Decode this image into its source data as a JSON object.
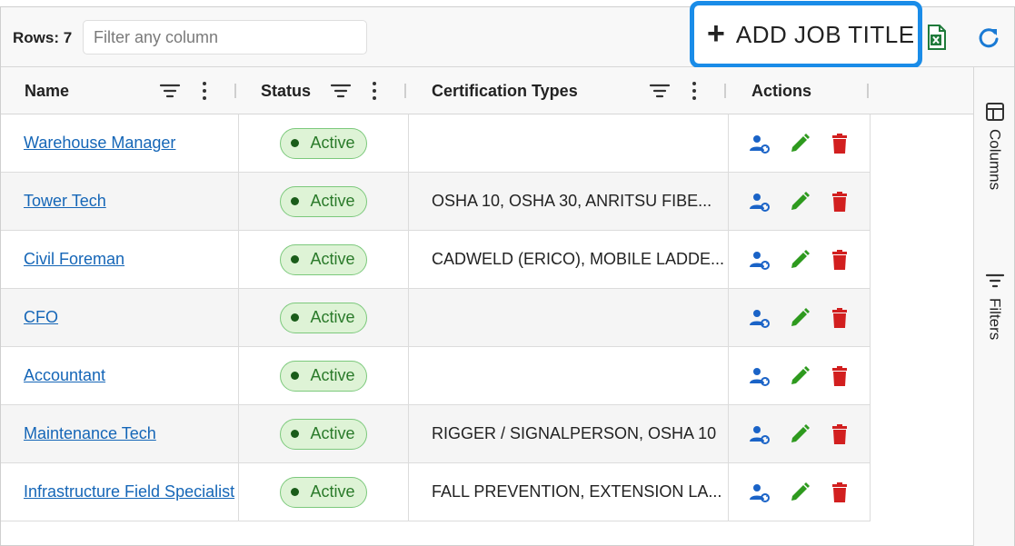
{
  "toolbar": {
    "rows_label": "Rows: 7",
    "filter_placeholder": "Filter any column",
    "filter_value": "",
    "add_button_label": "ADD JOB TITLE",
    "accent_color": "#1a8ce8"
  },
  "columns": {
    "name": "Name",
    "status": "Status",
    "certification_types": "Certification Types",
    "actions": "Actions"
  },
  "sidebar": {
    "columns_label": "Columns",
    "filters_label": "Filters"
  },
  "rows": [
    {
      "name": "Warehouse Manager",
      "status": "Active",
      "certifications": ""
    },
    {
      "name": "Tower Tech",
      "status": "Active",
      "certifications": "OSHA 10, OSHA 30, ANRITSU FIBE..."
    },
    {
      "name": "Civil Foreman",
      "status": "Active",
      "certifications": "CADWELD (ERICO), MOBILE LADDE..."
    },
    {
      "name": "CFO",
      "status": "Active",
      "certifications": ""
    },
    {
      "name": "Accountant",
      "status": "Active",
      "certifications": ""
    },
    {
      "name": "Maintenance Tech",
      "status": "Active",
      "certifications": "RIGGER / SIGNALPERSON, OSHA 10"
    },
    {
      "name": "Infrastructure Field Specialist",
      "status": "Active",
      "certifications": "FALL PREVENTION, EXTENSION LA..."
    }
  ],
  "icons": {
    "add": "plus-icon",
    "export": "excel-export-icon",
    "refresh": "refresh-icon",
    "filter": "filter-lines-icon",
    "menu": "vertical-dots-icon",
    "assign": "user-sync-icon",
    "edit": "pencil-icon",
    "delete": "trash-icon",
    "columns": "table-columns-icon"
  },
  "colors": {
    "link": "#1566b7",
    "status_bg": "#def3d6",
    "status_border": "#7cc97c",
    "assign_icon": "#1a63c7",
    "edit_icon": "#2e9a1e",
    "delete_icon": "#d21f1f",
    "excel_icon": "#1f7a3a",
    "refresh_icon": "#1a7ad4"
  }
}
